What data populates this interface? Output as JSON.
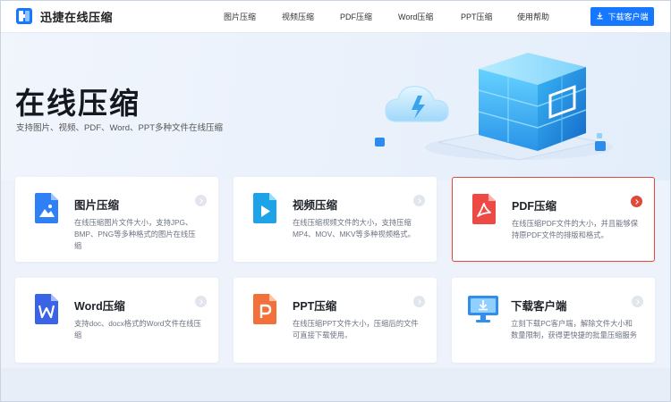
{
  "app": {
    "title": "迅捷在线压缩"
  },
  "nav": {
    "items": [
      {
        "label": "图片压缩"
      },
      {
        "label": "视频压缩"
      },
      {
        "label": "PDF压缩"
      },
      {
        "label": "Word压缩"
      },
      {
        "label": "PPT压缩"
      },
      {
        "label": "使用帮助"
      }
    ],
    "download_label": "下载客户端"
  },
  "hero": {
    "title": "在线压缩",
    "subtitle": "支持图片、视频、PDF、Word、PPT多种文件在线压缩"
  },
  "cards": [
    {
      "title": "图片压缩",
      "desc": "在线压缩图片文件大小，支持JPG、BMP、PNG等多种格式的图片在线压缩",
      "icon": "image-file-icon",
      "color": "#2f7ff5"
    },
    {
      "title": "视频压缩",
      "desc": "在线压缩视频文件的大小，支持压缩MP4、MOV、MKV等多种视频格式。",
      "icon": "video-file-icon",
      "color": "#1ea3e8"
    },
    {
      "title": "PDF压缩",
      "desc": "在线压缩PDF文件的大小，并且能够保持原PDF文件的排版和格式。",
      "icon": "pdf-file-icon",
      "color": "#ee4a45",
      "active": true
    },
    {
      "title": "Word压缩",
      "desc": "支持doc、docx格式的Word文件在线压缩",
      "icon": "word-file-icon",
      "color": "#3a63e6"
    },
    {
      "title": "PPT压缩",
      "desc": "在线压缩PPT文件大小，压缩后的文件可直接下载使用。",
      "icon": "ppt-file-icon",
      "color": "#f2713a"
    },
    {
      "title": "下载客户端",
      "desc": "立刻下载PC客户端，解除文件大小和数量限制，获得更快捷的批量压缩服务",
      "icon": "desktop-download-icon",
      "color": "#2f8ef0"
    }
  ],
  "colors": {
    "accent": "#1677ff",
    "active_border": "#e0483a"
  }
}
